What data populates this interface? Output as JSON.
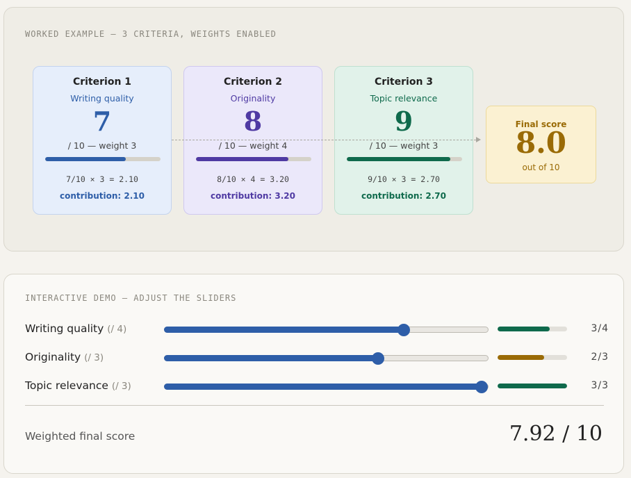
{
  "worked_example": {
    "label": "WORKED EXAMPLE — 3 CRITERIA, WEIGHTS ENABLED",
    "criteria": [
      {
        "title": "Criterion 1",
        "name": "Writing quality",
        "score": "7",
        "weight_text": "/ 10 — weight 3",
        "fraction": 0.7,
        "calc": "7/10 × 3 = 2.10",
        "contribution": "contribution: 2.10",
        "color": "#2e5ea8"
      },
      {
        "title": "Criterion 2",
        "name": "Originality",
        "score": "8",
        "weight_text": "/ 10 — weight 4",
        "fraction": 0.8,
        "calc": "8/10 × 4 = 3.20",
        "contribution": "contribution: 3.20",
        "color": "#4f3aa3"
      },
      {
        "title": "Criterion 3",
        "name": "Topic relevance",
        "score": "9",
        "weight_text": "/ 10 — weight 3",
        "fraction": 0.9,
        "calc": "9/10 × 3 = 2.70",
        "contribution": "contribution: 2.70",
        "color": "#0f6a4c"
      }
    ],
    "final": {
      "label": "Final score",
      "score": "8.0",
      "out_of": "out of 10",
      "color": "#9a6b06"
    }
  },
  "demo": {
    "label": "INTERACTIVE DEMO — ADJUST THE SLIDERS",
    "sliders": [
      {
        "name": "Writing quality",
        "max_label": "(/ 4)",
        "slider_fraction": 0.74,
        "value_text": "3/4",
        "bar_fraction": 0.75,
        "bar_color": "#0f6a4c"
      },
      {
        "name": "Originality",
        "max_label": "(/ 3)",
        "slider_fraction": 0.66,
        "value_text": "2/3",
        "bar_fraction": 0.67,
        "bar_color": "#9a6b06"
      },
      {
        "name": "Topic relevance",
        "max_label": "(/ 3)",
        "slider_fraction": 0.98,
        "value_text": "3/3",
        "bar_fraction": 1.0,
        "bar_color": "#0f6a4c"
      }
    ],
    "weighted_label": "Weighted final score",
    "weighted_value": "7.92 / 10"
  }
}
